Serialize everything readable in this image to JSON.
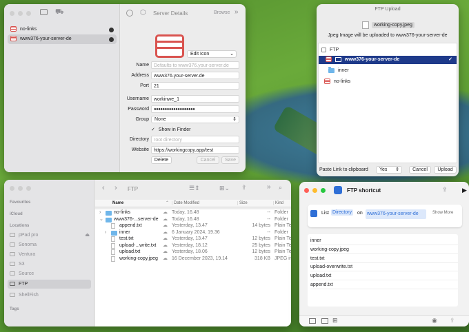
{
  "server_window": {
    "title": "Server Details",
    "browse_label": "Browse",
    "sidebar_items": [
      {
        "label": "no-links",
        "selected": false
      },
      {
        "label": "www376-your-server-de",
        "selected": true
      }
    ],
    "edit_icon_label": "Edit Icon",
    "fields": {
      "name_label": "Name",
      "name_placeholder": "Defaults to www376.your-server.de",
      "address_label": "Address",
      "address_value": "www376.your-server.de",
      "port_label": "Port",
      "port_value": "21",
      "username_label": "Username",
      "username_value": "workinwe_1",
      "password_label": "Password",
      "password_value": "●●●●●●●●●●●●●●●●●●●",
      "group_label": "Group",
      "group_value": "None",
      "show_in_finder_label": "Show in Finder",
      "directory_label": "Directory",
      "directory_placeholder": "root directory",
      "website_label": "Website",
      "website_value": "https://workingcopy.app/test"
    },
    "delete_label": "Delete",
    "cancel_label": "Cancel",
    "save_label": "Save"
  },
  "ftp_upload": {
    "title": "FTP Upload",
    "file_name": "working-copy.jpeg",
    "message": "Jpeg Image will be uploaded to www376-your-server-de",
    "tree": [
      {
        "label": "FTP",
        "kind": "root"
      },
      {
        "label": "www376-your-server-de",
        "kind": "server",
        "selected": true
      },
      {
        "label": "inner",
        "kind": "folder"
      },
      {
        "label": "no-links",
        "kind": "server"
      }
    ],
    "checkmark": "✓",
    "paste_link_label": "Paste Link to clipboard",
    "paste_link_value": "Yes",
    "cancel_label": "Cancel",
    "upload_label": "Upload"
  },
  "finder": {
    "title": "FTP",
    "sidebar": {
      "favourites_label": "Favourites",
      "icloud_label": "iCloud",
      "locations_label": "Locations",
      "locations": [
        "pPad pro",
        "Sonoma",
        "Ventura",
        "S3",
        "Source",
        "FTP",
        "ShellFish"
      ],
      "selected": "FTP",
      "tags_label": "Tags"
    },
    "columns": {
      "name": "Name",
      "date": "Date Modified",
      "size": "Size",
      "kind": "Kind"
    },
    "rows": [
      {
        "name": "no-links",
        "date": "Today, 16.48",
        "size": "--",
        "kind": "Folder",
        "type": "folder",
        "indent": 0,
        "arrow": "›"
      },
      {
        "name": "www376-...server-de",
        "date": "Today, 16.48",
        "size": "--",
        "kind": "Folder",
        "type": "folder",
        "indent": 0,
        "arrow": "⌄"
      },
      {
        "name": "append.txt",
        "date": "Yesterday, 13.47",
        "size": "14 bytes",
        "kind": "Plain Text",
        "type": "doc",
        "indent": 1,
        "arrow": ""
      },
      {
        "name": "inner",
        "date": "6 January 2024, 19.36",
        "size": "--",
        "kind": "Folder",
        "type": "folder",
        "indent": 1,
        "arrow": "›"
      },
      {
        "name": "test.txt",
        "date": "Yesterday, 13.47",
        "size": "12 bytes",
        "kind": "Plain Text",
        "type": "doc",
        "indent": 1,
        "arrow": ""
      },
      {
        "name": "upload-...write.txt",
        "date": "Yesterday, 18.12",
        "size": "25 bytes",
        "kind": "Plain Text",
        "type": "doc",
        "indent": 1,
        "arrow": ""
      },
      {
        "name": "upload.txt",
        "date": "Yesterday, 18.06",
        "size": "12 bytes",
        "kind": "Plain Text",
        "type": "doc",
        "indent": 1,
        "arrow": ""
      },
      {
        "name": "working-copy.jpeg",
        "date": "16 December 2023, 19.14",
        "size": "318 KB",
        "kind": "JPEG image",
        "type": "doc",
        "indent": 1,
        "arrow": ""
      }
    ]
  },
  "shortcut": {
    "title": "FTP shortcut",
    "action_verb": "List",
    "action_param": "Directory",
    "action_on": "on",
    "action_target": "www376-your-server-de",
    "show_more_label": "Show More",
    "results": [
      "inner",
      "working-copy.jpeg",
      "test.txt",
      "upload-overwrite.txt",
      "upload.txt",
      "append.txt"
    ]
  }
}
